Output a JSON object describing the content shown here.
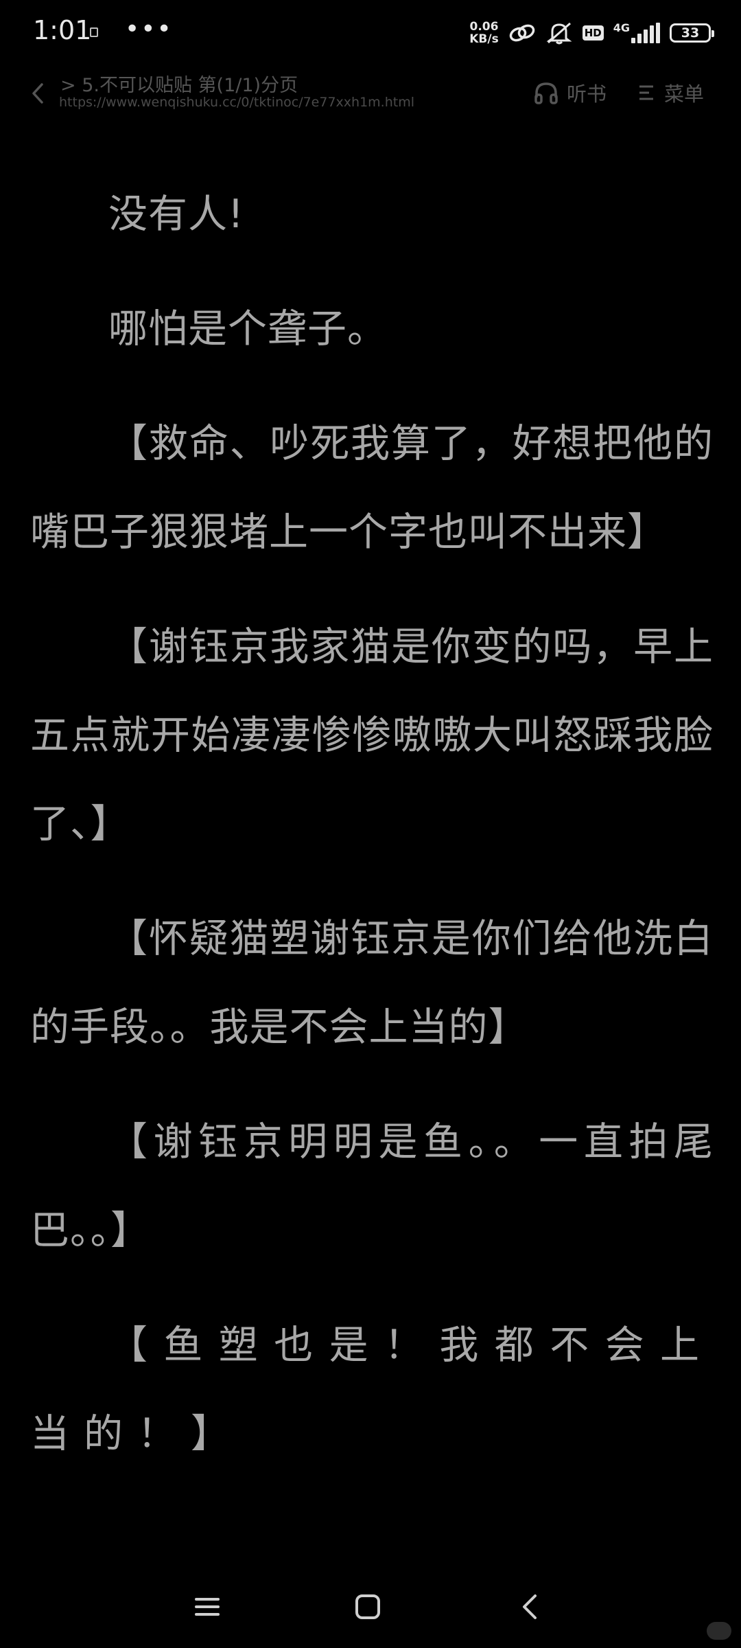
{
  "status_bar": {
    "time": "1:01",
    "dots": "•••",
    "net_speed_value": "0.06",
    "net_speed_unit": "KB/s",
    "hd_label": "HD",
    "network_type": "4G",
    "battery_level": "33"
  },
  "header": {
    "title": "> 5.不可以贴贴 第(1/1)分页",
    "url": "https://www.wenqishuku.cc/0/tktinoc/7e77xxh1m.html",
    "listen_label": "听书",
    "menu_label": "菜单"
  },
  "content": {
    "paragraphs": [
      "没有人!",
      "哪怕是个聋子。",
      "【救命、吵死我算了，好想把他的嘴巴子狠狠堵上一个字也叫不出来】",
      "【谢钰京我家猫是你变的吗，早上五点就开始凄凄惨惨嗷嗷大叫怒踩我脸了、】",
      "【怀疑猫塑谢钰京是你们给他洗白的手段。。我是不会上当的】",
      "【谢钰京明明是鱼。。一直拍尾巴。。】",
      "【鱼塑也是！我都不会上当的！】"
    ]
  },
  "icons": {
    "back": "chevron-left-icon",
    "listen": "headphones-icon",
    "menu": "menu-list-icon",
    "nav_recents": "recents-icon",
    "nav_home": "home-icon",
    "nav_back": "back-icon"
  },
  "colors": {
    "background": "#000000",
    "text": "#a8a8a8",
    "header_text": "#555555"
  }
}
